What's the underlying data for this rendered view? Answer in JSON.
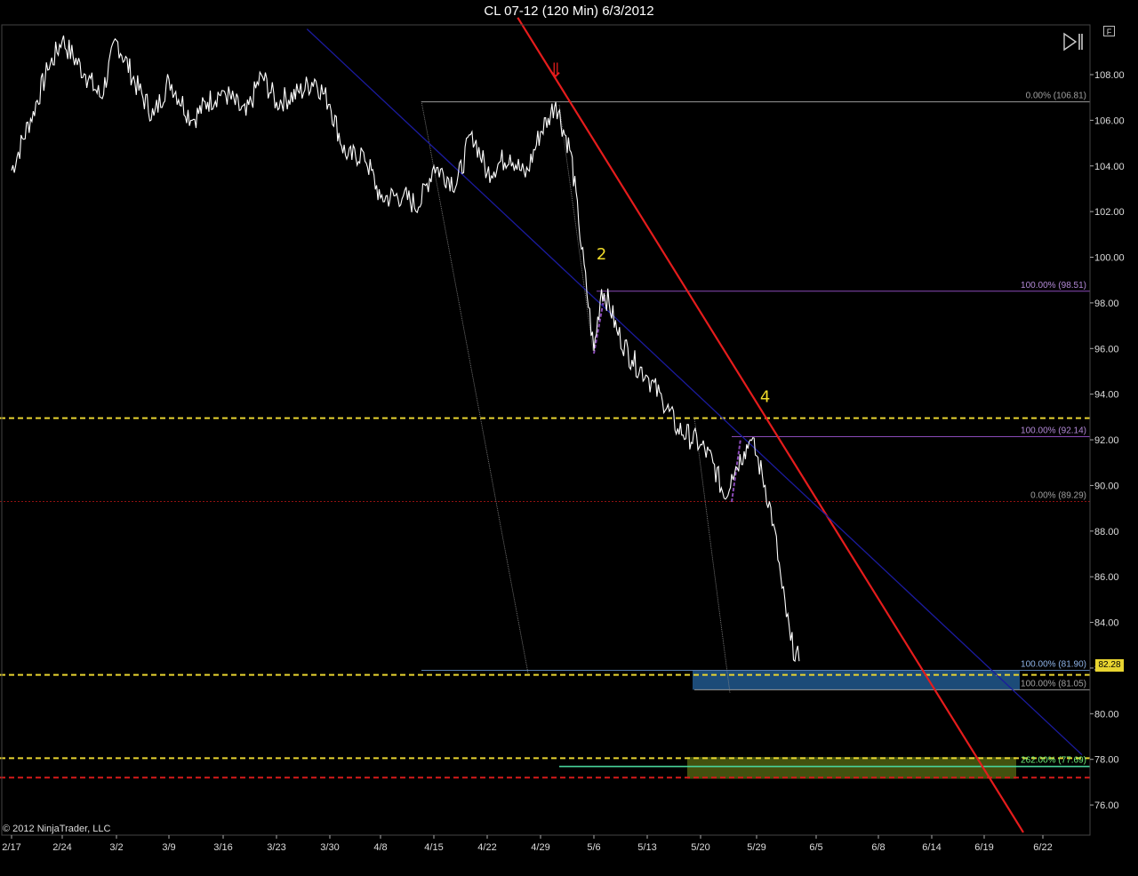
{
  "window": {
    "title": "CL 07-12 (120 Min)  6/3/2012"
  },
  "copyright": "© 2012 NinjaTrader, LLC",
  "buttons": {
    "f_label": "F"
  },
  "icons": {
    "replay": "skip-forward-icon"
  },
  "colors": {
    "background": "#000000",
    "price": "#ffffff",
    "red_trend": "#e51c1c",
    "blue_trend": "#1b1b9e",
    "yellow_level": "#e8d430",
    "red_level": "#d61a1a",
    "fib_purple": "#8a4bb8",
    "fib_gray": "#9a9a9a",
    "blue_zone": "#1e4f7e",
    "green_zone": "#4a5a10",
    "label_yellow": "#f2dc2a"
  },
  "chart_data": {
    "type": "line",
    "title": "CL 07-12 (120 Min)  6/3/2012",
    "xlabel": "",
    "ylabel": "",
    "ylim": [
      75.0,
      109.8
    ],
    "x_ticks": [
      "2/17",
      "2/24",
      "3/2",
      "3/9",
      "3/16",
      "3/23",
      "3/30",
      "4/8",
      "4/15",
      "4/22",
      "4/29",
      "5/6",
      "5/13",
      "5/20",
      "5/29",
      "6/5",
      "6/8",
      "6/14",
      "6/19",
      "6/22"
    ],
    "y_ticks": [
      "76.00",
      "78.00",
      "80.00",
      "82.00",
      "84.00",
      "86.00",
      "88.00",
      "90.00",
      "92.00",
      "94.00",
      "96.00",
      "98.00",
      "100.00",
      "102.00",
      "104.00",
      "106.00",
      "108.00"
    ],
    "last_price": "82.28",
    "series": [
      {
        "x": [
          "2/17",
          "2/20",
          "2/22",
          "2/24",
          "2/27",
          "2/29",
          "3/2",
          "3/5",
          "3/7",
          "3/9",
          "3/12",
          "3/14",
          "3/16",
          "3/19",
          "3/21",
          "3/23",
          "3/26",
          "3/28",
          "3/30",
          "4/2",
          "4/5",
          "4/8",
          "4/11",
          "4/13",
          "4/15",
          "4/18",
          "4/20",
          "4/22",
          "4/25",
          "4/27",
          "4/29",
          "4/30",
          "5/1",
          "5/2",
          "5/3",
          "5/4",
          "5/6",
          "5/7",
          "5/8",
          "5/9",
          "5/11",
          "5/13",
          "5/15",
          "5/17",
          "5/20",
          "5/22",
          "5/24",
          "5/25",
          "5/27",
          "5/28",
          "5/29",
          "5/30",
          "5/31",
          "6/1",
          "6/2",
          "6/3"
        ],
        "values": [
          103.8,
          106.4,
          108.2,
          109.5,
          108.0,
          107.0,
          109.5,
          107.3,
          106.2,
          107.8,
          106.0,
          106.8,
          107.3,
          106.2,
          108.0,
          106.8,
          107.2,
          107.8,
          106.7,
          104.3,
          104.6,
          102.6,
          102.7,
          102.2,
          104.0,
          103.2,
          105.5,
          103.7,
          104.5,
          103.5,
          105.5,
          106.1,
          106.8,
          105.6,
          104.6,
          101.5,
          95.9,
          98.6,
          98.0,
          96.8,
          95.5,
          94.8,
          93.7,
          92.5,
          91.8,
          91.0,
          89.4,
          90.5,
          91.5,
          92.0,
          91.3,
          90.0,
          88.3,
          85.5,
          83.2,
          82.3
        ]
      }
    ],
    "lines": [
      {
        "kind": "trend",
        "color": "red_trend",
        "from": {
          "x": "4/26",
          "y": 110.5
        },
        "to": {
          "x": "6/21",
          "y": 74.8
        }
      },
      {
        "kind": "trend",
        "color": "blue_trend",
        "from": {
          "x": "3/27",
          "y": 110.0
        },
        "to": {
          "x": "6/24",
          "y": 78.2
        }
      },
      {
        "kind": "hline",
        "color": "yellow_level",
        "y": 92.95,
        "style": "dashed"
      },
      {
        "kind": "hline",
        "color": "yellow_level",
        "y": 81.7,
        "style": "dashed"
      },
      {
        "kind": "hline",
        "color": "yellow_level",
        "y": 78.05,
        "style": "dashed"
      },
      {
        "kind": "hline",
        "color": "red_level",
        "y": 77.2,
        "style": "dashed"
      },
      {
        "kind": "hline",
        "color": "red_level",
        "y": 89.29,
        "style": "dotted-thin"
      }
    ],
    "fib_levels": [
      {
        "label": "0.00% (106.81)",
        "y": 106.81,
        "color": "fib_gray"
      },
      {
        "label": "100.00% (98.51)",
        "y": 98.51,
        "color": "fib_purple"
      },
      {
        "label": "100.00% (92.14)",
        "y": 92.14,
        "color": "fib_purple"
      },
      {
        "label": "0.00% (89.29)",
        "y": 89.29,
        "color": "fib_gray"
      },
      {
        "label": "100.00% (81.90)",
        "y": 81.9,
        "color": "blue_zone"
      },
      {
        "label": "100.00% (81.05)",
        "y": 81.05,
        "color": "fib_gray"
      },
      {
        "label": "262.00% (77.69)",
        "y": 77.69,
        "color": "label_yellow"
      }
    ],
    "zones": [
      {
        "color": "blue_zone",
        "y_top": 81.9,
        "y_bottom": 81.05
      },
      {
        "color": "green_zone",
        "y_top": 78.1,
        "y_bottom": 77.15
      }
    ],
    "annotations": [
      {
        "text": "2",
        "x": "5/7",
        "y": 99.9
      },
      {
        "text": "4",
        "x": "5/30",
        "y": 93.65
      },
      {
        "text": "⇓",
        "x": "5/1",
        "y": 107.9
      }
    ]
  }
}
